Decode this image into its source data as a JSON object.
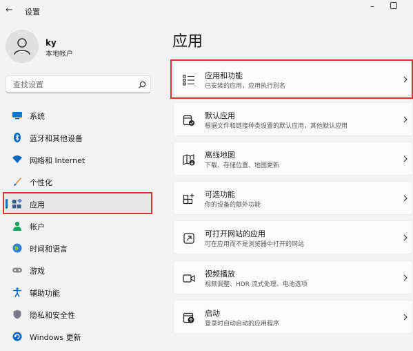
{
  "window": {
    "title": "设置",
    "back_glyph": "←",
    "minimize_glyph": "–"
  },
  "profile": {
    "name": "ky",
    "account_type": "本地帐户"
  },
  "search": {
    "placeholder": "查找设置"
  },
  "sidebar": {
    "items": [
      {
        "label": "系统",
        "icon": "system-icon",
        "color": "#0078d4"
      },
      {
        "label": "蓝牙和其他设备",
        "icon": "bluetooth-icon",
        "color": "#0067c0"
      },
      {
        "label": "网络和 Internet",
        "icon": "network-icon",
        "color": "#0067c0"
      },
      {
        "label": "个性化",
        "icon": "brush-icon",
        "color": "#e07b39"
      },
      {
        "label": "应用",
        "icon": "apps-icon",
        "color": "#3a5a8c",
        "selected": true
      },
      {
        "label": "帐户",
        "icon": "accounts-icon",
        "color": "#1aa35a"
      },
      {
        "label": "时间和语言",
        "icon": "time-language-icon",
        "color": "#2a7fd4"
      },
      {
        "label": "游戏",
        "icon": "gaming-icon",
        "color": "#8a8a8a"
      },
      {
        "label": "辅助功能",
        "icon": "accessibility-icon",
        "color": "#0067c0"
      },
      {
        "label": "隐私和安全性",
        "icon": "shield-icon",
        "color": "#7a7a8a"
      },
      {
        "label": "Windows 更新",
        "icon": "windows-update-icon",
        "color": "#0067c0"
      }
    ]
  },
  "main": {
    "title": "应用",
    "cards": [
      {
        "title": "应用和功能",
        "subtitle": "已安装的应用，应用执行别名",
        "icon": "apps-features-icon"
      },
      {
        "title": "默认应用",
        "subtitle": "根据文件和链接种类设置的默认应用，其他默认应用",
        "icon": "default-apps-icon"
      },
      {
        "title": "离线地图",
        "subtitle": "下载、存储位置、地图更新",
        "icon": "offline-maps-icon"
      },
      {
        "title": "可选功能",
        "subtitle": "你的设备的额外功能",
        "icon": "optional-features-icon"
      },
      {
        "title": "可打开网站的应用",
        "subtitle": "可在应用而不是浏览器中打开的网站",
        "icon": "apps-for-websites-icon"
      },
      {
        "title": "视频播放",
        "subtitle": "视频调整、HDR 流式处理、电池选项",
        "icon": "video-playback-icon"
      },
      {
        "title": "启动",
        "subtitle": "登录时自动启动的应用程序",
        "icon": "startup-icon"
      }
    ]
  },
  "accent": "#0067c0",
  "highlight_border": "#e03030"
}
